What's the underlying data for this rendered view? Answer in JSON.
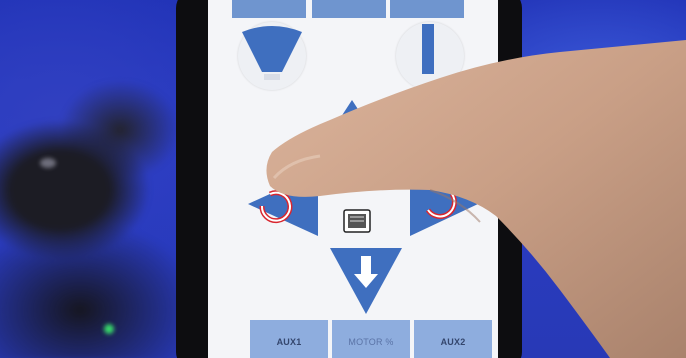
{
  "scene": {
    "description_type": "photo of a hand operating a camera-rig control app on a smartphone",
    "colors": {
      "backdrop": "#2a3cc4",
      "screen": "#f4f5f8",
      "button_fill": "#8eadde",
      "arrow_fill": "#3f6fbf",
      "rotate_red": "#d8262f",
      "skin": "#c99f86"
    }
  },
  "app": {
    "top_tabs": [
      "",
      "",
      ""
    ],
    "icons": {
      "tilt": "tilt-fan-icon",
      "height": "height-bar-icon",
      "arrow_up": "arrow-up-icon",
      "arrow_down": "arrow-down-icon",
      "rotate_left": "rotate-left-icon",
      "rotate_right": "rotate-right-icon",
      "center": "phone-center-icon"
    },
    "bottom_buttons": {
      "aux1": "AUX1",
      "motor": "MOTOR %",
      "aux2": "AUX2"
    }
  }
}
